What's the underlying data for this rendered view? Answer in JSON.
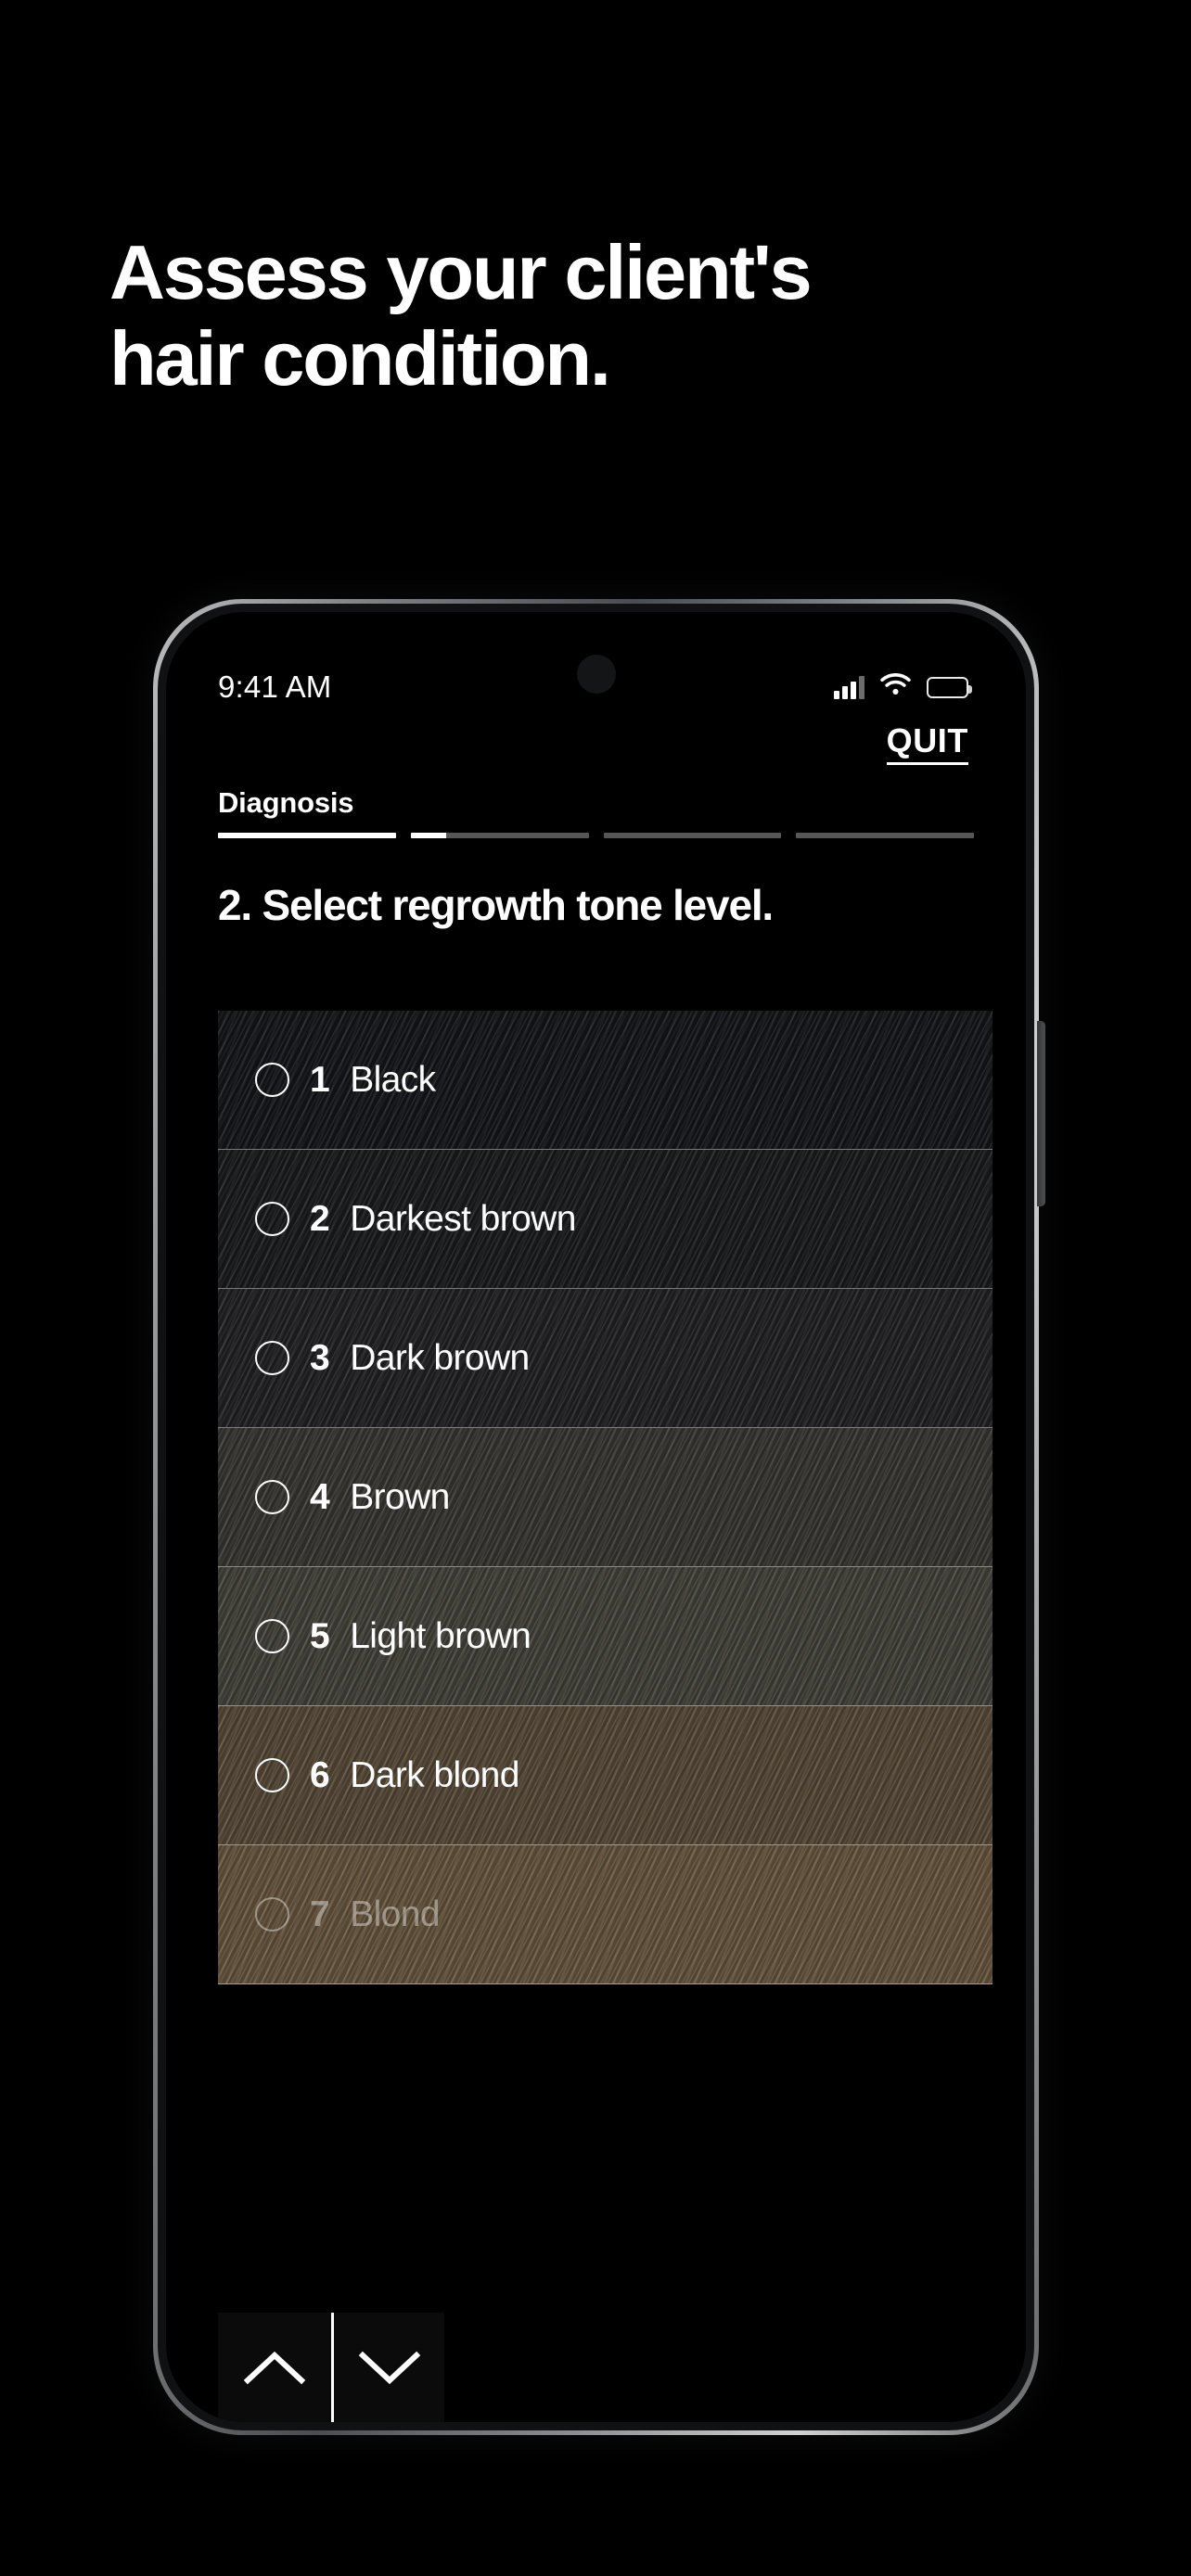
{
  "headline": {
    "line1": "Assess your client's",
    "line2": "hair condition."
  },
  "phone": {
    "statusbar": {
      "time": "9:41 AM",
      "icons": [
        "signal-icon",
        "wifi-icon",
        "battery-icon"
      ]
    },
    "header": {
      "quit_label": "QUIT"
    },
    "tabs": {
      "active_label": "Diagnosis",
      "segments": [
        {
          "fill_percent": 100
        },
        {
          "fill_percent": 20
        },
        {
          "fill_percent": 0
        },
        {
          "fill_percent": 0
        }
      ]
    },
    "question": "2. Select regrowth tone level.",
    "tone_options": [
      {
        "number": "1",
        "name": "Black",
        "selected": false,
        "swatch": "#15161a"
      },
      {
        "number": "2",
        "name": "Darkest brown",
        "selected": false,
        "swatch": "#1a1b1d"
      },
      {
        "number": "3",
        "name": "Dark brown",
        "selected": false,
        "swatch": "#222224"
      },
      {
        "number": "4",
        "name": "Brown",
        "selected": false,
        "swatch": "#3a3833"
      },
      {
        "number": "5",
        "name": "Light brown",
        "selected": false,
        "swatch": "#47443c"
      },
      {
        "number": "6",
        "name": "Dark blond",
        "selected": false,
        "swatch": "#5a4c39"
      },
      {
        "number": "7",
        "name": "Blond",
        "selected": false,
        "swatch": "#6b5940"
      }
    ],
    "scroll_nav": {
      "up_label": "chevron-up-icon",
      "down_label": "chevron-down-icon"
    }
  },
  "colors": {
    "background": "#000000",
    "text": "#ffffff",
    "progress_inactive": "#565656"
  }
}
